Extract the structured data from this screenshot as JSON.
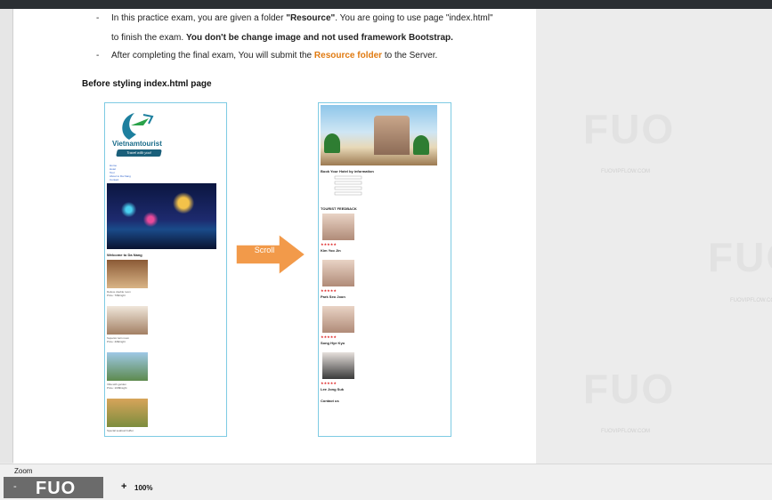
{
  "document": {
    "line1_pre": "In this practice exam, you are given a folder ",
    "line1_bold": "\"Resource\"",
    "line1_post": ". You are going to use page \"index.html\"",
    "line2_pre": "to finish the exam. ",
    "line2_bold": "You don't be change image and not used framework Bootstrap.",
    "line3_pre": "After completing the final exam, You will submit the ",
    "line3_orange": "Resource folder",
    "line3_post": " to the Server.",
    "bullet": "-",
    "heading": "Before styling index.html page"
  },
  "left_mockup": {
    "logo_text": "Vietnamtourist",
    "logo_tagline": "Travel with you!",
    "nav_items": [
      "Home",
      "Hotel",
      "Tour",
      "About to Da Nang",
      "Contact"
    ],
    "welcome": "Welcome to Da Nang",
    "items": [
      {
        "name": "Deluxe double room",
        "price": "Price: 70$/night"
      },
      {
        "name": "Superior twin room",
        "price": "Price: 40$/night"
      },
      {
        "name": "Villa with garden",
        "price": "Price: 100$/night"
      },
      {
        "name": "Special seafood buffet",
        "price": "Price: 35$/person"
      }
    ]
  },
  "right_mockup": {
    "form_title": "Book Your Hotel by information",
    "feedback_title": "TOURIST FEEDBACK",
    "stars": "★★★★★",
    "reviewers": [
      "Kim Yoo Jin",
      "Park Seo Joon",
      "Song Hye Kyo",
      "Lee Jong Suk"
    ],
    "footer_title": "Contact us"
  },
  "arrow": {
    "label": "Scroll",
    "color": "#f29a4a"
  },
  "watermark": {
    "text": "FUO",
    "sub": "FUOVIPFLOW.COM"
  },
  "zoom": {
    "label": "Zoom",
    "minus": "-",
    "plus": "+",
    "value": "100%",
    "logo": "FUO"
  }
}
